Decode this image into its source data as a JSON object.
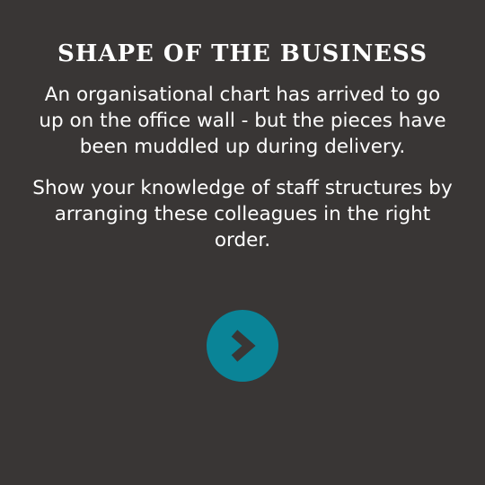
{
  "screen": {
    "title": "SHAPE OF THE BUSINESS",
    "intro": "An organisational chart has arrived to go up on the office wall - but the pieces have been muddled up during delivery.",
    "instruction": "Show your knowledge of staff structures by arranging these colleagues in the right order."
  },
  "next_button": {
    "icon": "chevron-right-icon",
    "color": "#0a8497",
    "icon_color": "#393635"
  },
  "colors": {
    "background": "#393635",
    "text": "#ffffff"
  }
}
